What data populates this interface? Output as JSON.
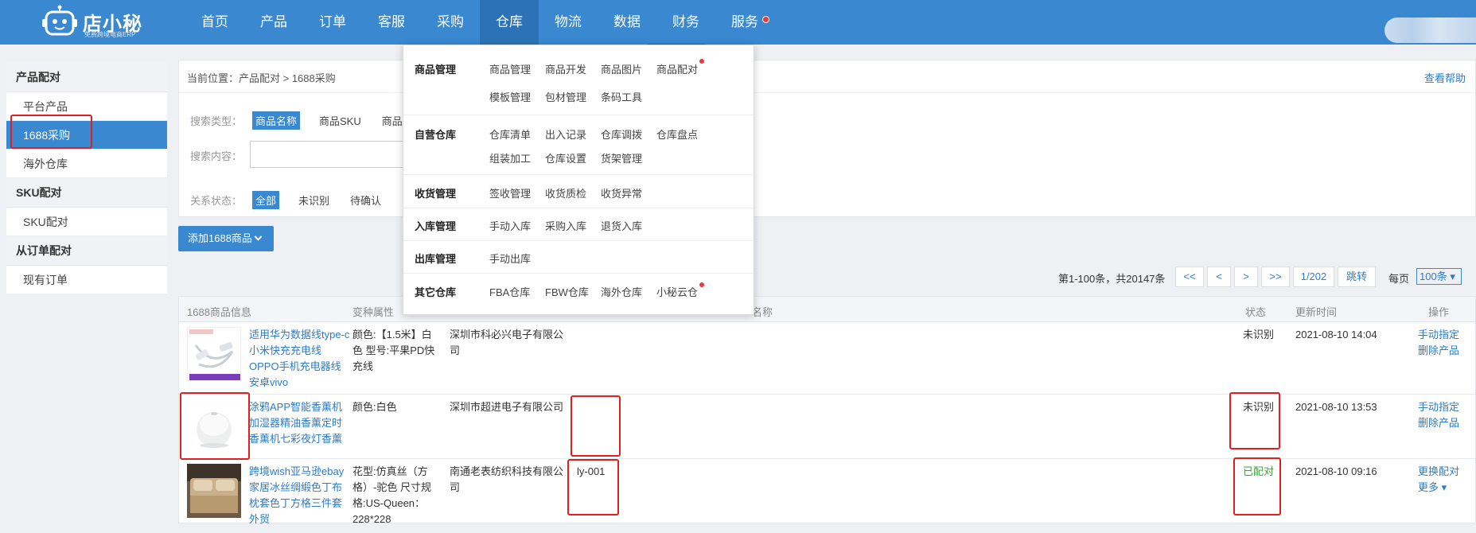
{
  "brand": {
    "name": "店小秘",
    "tagline": "免费跨境电商ERP"
  },
  "nav": [
    "首页",
    "产品",
    "订单",
    "客服",
    "采购",
    "仓库",
    "物流",
    "数据",
    "财务",
    "服务"
  ],
  "nav_active": "仓库",
  "sidebar": {
    "groups": [
      {
        "title": "产品配对",
        "items": [
          "平台产品",
          "1688采购",
          "海外仓库"
        ]
      },
      {
        "title": "SKU配对",
        "items": [
          "SKU配对"
        ]
      },
      {
        "title": "从订单配对",
        "items": [
          "现有订单"
        ]
      }
    ],
    "active_item": "1688采购"
  },
  "breadcrumb": {
    "label": "当前位置：",
    "path": "产品配对 > 1688采购"
  },
  "help": "查看帮助",
  "filters": {
    "search_type_label": "搜索类型：",
    "search_types": [
      "商品名称",
      "商品SKU",
      "商品"
    ],
    "search_content_label": "搜索内容：",
    "relation_label": "关系状态：",
    "relations": [
      "全部",
      "未识别",
      "待确认"
    ]
  },
  "add_button": "添加1688商品",
  "pagination": {
    "info": "第1-100条，共20147条",
    "first": "<<",
    "prev": "<",
    "next": ">",
    "last": ">>",
    "page": "1/202",
    "jump": "跳转",
    "per_label": "每页",
    "per_value": "100条"
  },
  "table": {
    "headers": {
      "info": "1688商品信息",
      "attr": "变种属性",
      "name": "名称",
      "status": "状态",
      "time": "更新时间",
      "op": "操作"
    },
    "rows": [
      {
        "title": "适用华为数据线type-c小米快充充电线OPPO手机充电器线安卓vivo",
        "attr": "颜色:【1.5米】白色 型号:平果PD快充线",
        "supplier": "深圳市科必兴电子有限公司",
        "sku": "",
        "status": "未识别",
        "time": "2021-08-10 14:04",
        "ops": [
          "手动指定",
          "删除产品"
        ]
      },
      {
        "title": "涂鸦APP智能香薰机加湿器精油香薰定时香薰机七彩夜灯香薰",
        "attr": "颜色:白色",
        "supplier": "深圳市超进电子有限公司",
        "sku": "",
        "status": "未识别",
        "time": "2021-08-10 13:53",
        "ops": [
          "手动指定",
          "删除产品"
        ]
      },
      {
        "title": "跨境wish亚马逊ebay家居冰丝绸缎色丁布枕套色丁方格三件套外贸",
        "attr": "花型:仿真丝（方格）-驼色 尺寸规格:US-Queen：228*228",
        "supplier": "南通老表纺织科技有限公司",
        "sku": "ly-001",
        "status": "已配对",
        "time": "2021-08-10 09:16",
        "ops": [
          "更换配对",
          "更多"
        ]
      }
    ]
  },
  "mega_menu": [
    {
      "title": "商品管理",
      "links": [
        "商品管理",
        "商品开发",
        "商品图片",
        "商品配对",
        "模板管理",
        "包材管理",
        "条码工具"
      ]
    },
    {
      "title": "自营仓库",
      "links": [
        "仓库清单",
        "出入记录",
        "仓库调拨",
        "仓库盘点",
        "组装加工",
        "仓库设置",
        "货架管理"
      ]
    },
    {
      "title": "收货管理",
      "links": [
        "签收管理",
        "收货质检",
        "收货异常"
      ]
    },
    {
      "title": "入库管理",
      "links": [
        "手动入库",
        "采购入库",
        "退货入库"
      ]
    },
    {
      "title": "出库管理",
      "links": [
        "手动出库"
      ]
    },
    {
      "title": "其它仓库",
      "links": [
        "FBA仓库",
        "FBW仓库",
        "海外仓库",
        "小秘云仓"
      ]
    }
  ],
  "colors": {
    "primary": "#3a88cf",
    "highlight": "#e11f1f",
    "paired": "#3aa23a"
  }
}
